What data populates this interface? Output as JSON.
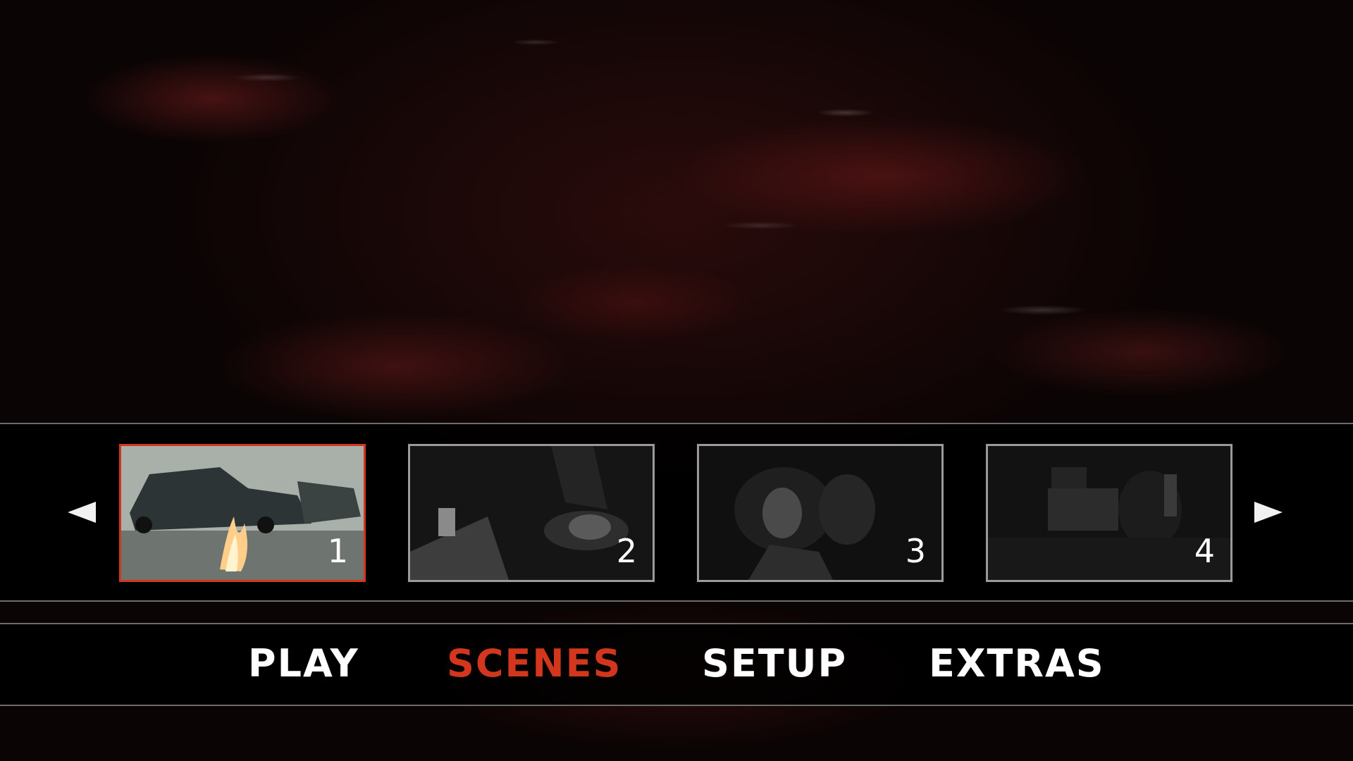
{
  "scene_selector": {
    "thumbnails": [
      {
        "number": "1",
        "selected": true
      },
      {
        "number": "2",
        "selected": false
      },
      {
        "number": "3",
        "selected": false
      },
      {
        "number": "4",
        "selected": false
      }
    ],
    "prev_icon": "left-triangle-arrow-icon",
    "next_icon": "right-triangle-arrow-icon"
  },
  "main_menu": {
    "items": [
      {
        "label": "PLAY"
      },
      {
        "label": "SCENES"
      },
      {
        "label": "SETUP"
      },
      {
        "label": "EXTRAS"
      }
    ],
    "active_index": 1
  },
  "colors": {
    "accent": "#d2371e",
    "text": "#ffffff",
    "frame": "#9a9a9a"
  }
}
